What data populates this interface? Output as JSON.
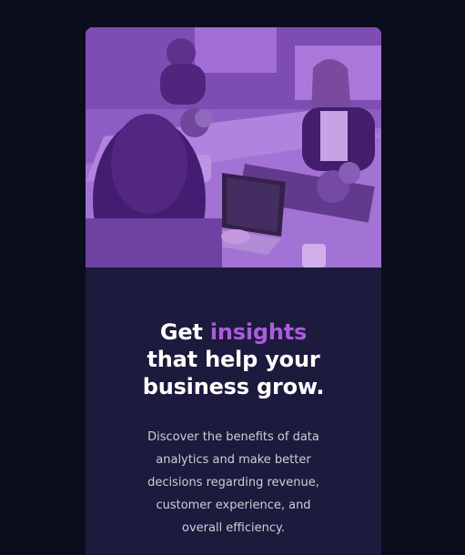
{
  "hero": {
    "image_alt": "Women collaborating at a table with laptops"
  },
  "headline": {
    "word_get": "Get",
    "word_insights": "insights",
    "line2": "that help your",
    "line3": "business grow."
  },
  "description": "Discover the benefits of data analytics and make better decisions regarding revenue, customer experience, and overall efficiency.",
  "colors": {
    "page_bg": "#0b0d1c",
    "card_bg": "#1c1a3d",
    "accent": "#ab5cdb",
    "hero_tint": "#9b6ac9"
  }
}
